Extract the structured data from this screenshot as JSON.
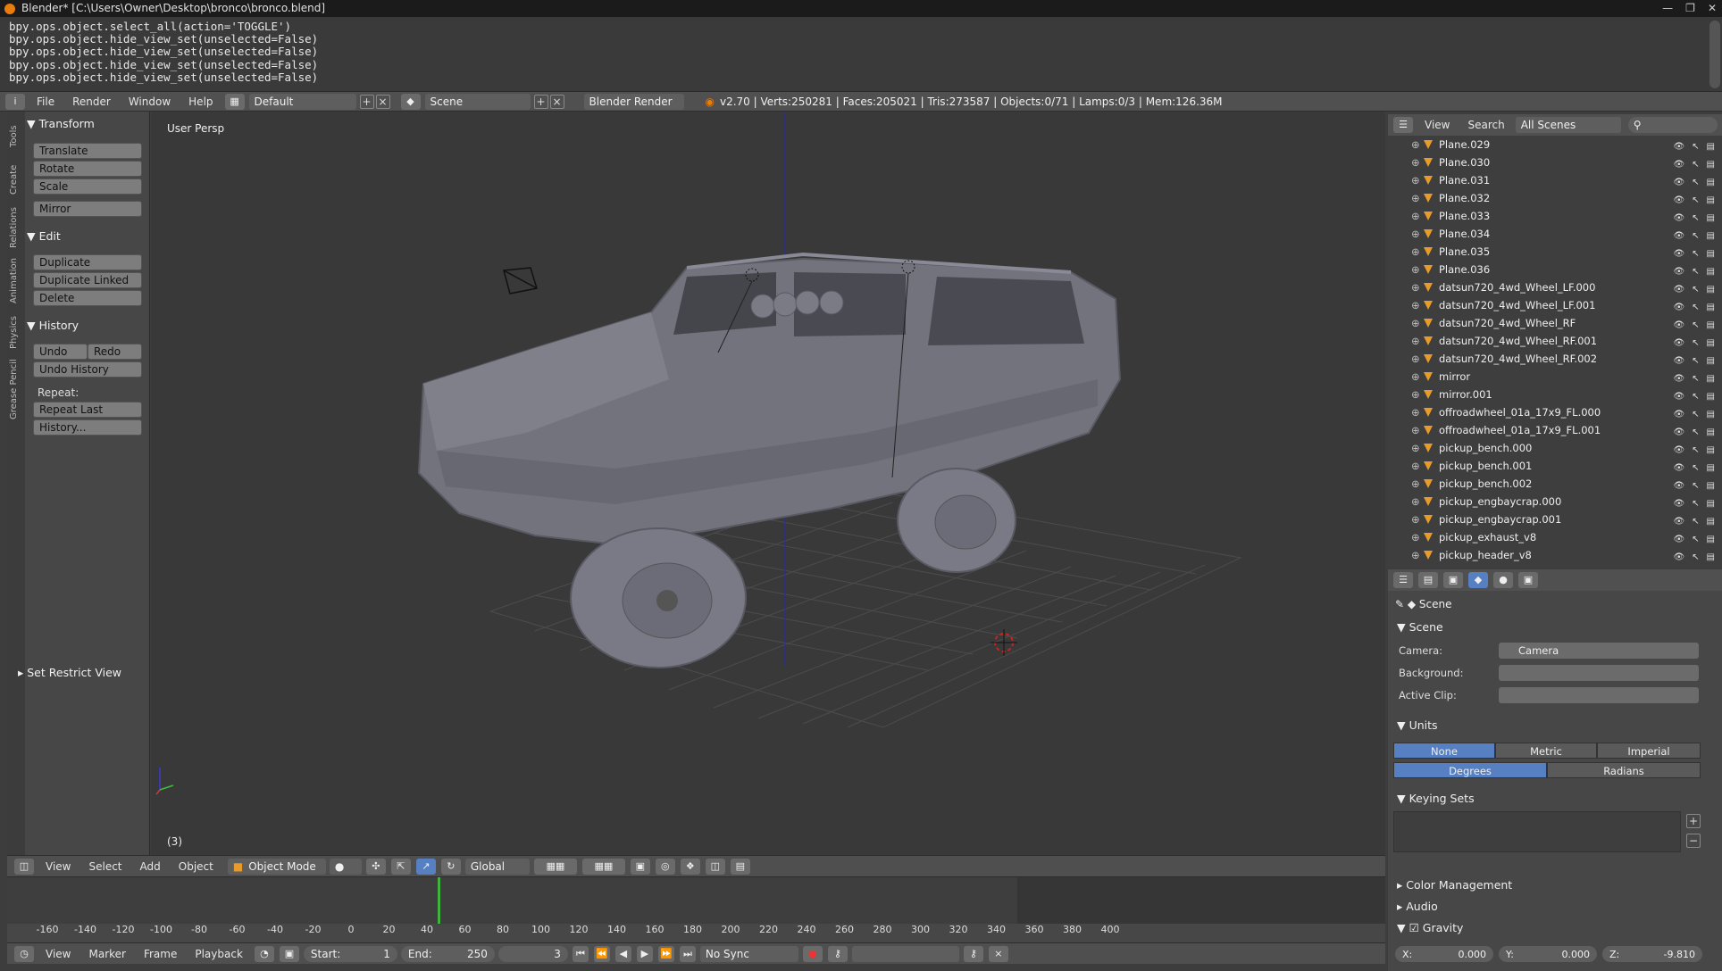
{
  "window": {
    "title": "Blender* [C:\\Users\\Owner\\Desktop\\bronco\\bronco.blend]"
  },
  "console": {
    "lines": [
      "bpy.ops.object.select_all(action='TOGGLE')",
      "bpy.ops.object.hide_view_set(unselected=False)",
      "bpy.ops.object.hide_view_set(unselected=False)",
      "bpy.ops.object.hide_view_set(unselected=False)",
      "bpy.ops.object.hide_view_set(unselected=False)"
    ]
  },
  "info": {
    "menus": [
      "File",
      "Render",
      "Window",
      "Help"
    ],
    "layout": "Default",
    "scene": "Scene",
    "engine": "Blender Render",
    "stats": "v2.70 | Verts:250281 | Faces:205021 | Tris:273587 | Objects:0/71 | Lamps:0/3 | Mem:126.36M"
  },
  "toolshelf": {
    "tabs": [
      "Tools",
      "Create",
      "Relations",
      "Animation",
      "Physics",
      "Grease Pencil"
    ],
    "transform_head": "Transform",
    "translate": "Translate",
    "rotate": "Rotate",
    "scale": "Scale",
    "mirror": "Mirror",
    "edit_head": "Edit",
    "duplicate": "Duplicate",
    "duplicate_linked": "Duplicate Linked",
    "delete": "Delete",
    "history_head": "History",
    "undo": "Undo",
    "redo": "Redo",
    "undo_history": "Undo History",
    "repeat_label": "Repeat:",
    "repeat_last": "Repeat Last",
    "history": "History...",
    "restrict": "Set Restrict View"
  },
  "viewport": {
    "label": "User Persp",
    "frame": "(3)"
  },
  "vp_header": {
    "menus": [
      "View",
      "Select",
      "Add",
      "Object"
    ],
    "mode": "Object Mode",
    "orientation": "Global"
  },
  "timeline": {
    "ticks": [
      "-160",
      "-140",
      "-120",
      "-100",
      "-80",
      "-60",
      "-40",
      "-20",
      "0",
      "20",
      "40",
      "60",
      "80",
      "100",
      "120",
      "140",
      "160",
      "180",
      "200",
      "220",
      "240",
      "260",
      "280",
      "300",
      "320",
      "340",
      "360",
      "380",
      "400"
    ],
    "menus": [
      "View",
      "Marker",
      "Frame",
      "Playback"
    ],
    "start_label": "Start:",
    "start": "1",
    "end_label": "End:",
    "end": "250",
    "current": "3",
    "sync": "No Sync"
  },
  "outliner": {
    "menus": [
      "View",
      "Search"
    ],
    "filter": "All Scenes",
    "rows": [
      "Plane.029",
      "Plane.030",
      "Plane.031",
      "Plane.032",
      "Plane.033",
      "Plane.034",
      "Plane.035",
      "Plane.036",
      "datsun720_4wd_Wheel_LF.000",
      "datsun720_4wd_Wheel_LF.001",
      "datsun720_4wd_Wheel_RF",
      "datsun720_4wd_Wheel_RF.001",
      "datsun720_4wd_Wheel_RF.002",
      "mirror",
      "mirror.001",
      "offroadwheel_01a_17x9_FL.000",
      "offroadwheel_01a_17x9_FL.001",
      "pickup_bench.000",
      "pickup_bench.001",
      "pickup_bench.002",
      "pickup_engbaycrap.000",
      "pickup_engbaycrap.001",
      "pickup_exhaust_v8",
      "pickup_header_v8"
    ]
  },
  "properties": {
    "context": "Scene",
    "scene_head": "Scene",
    "camera_label": "Camera:",
    "camera": "Camera",
    "background_label": "Background:",
    "background": "",
    "clip_label": "Active Clip:",
    "clip": "",
    "units_head": "Units",
    "unit_system": [
      "None",
      "Metric",
      "Imperial"
    ],
    "rotation_units": [
      "Degrees",
      "Radians"
    ],
    "keying_head": "Keying Sets",
    "color_mgmt": "Color Management",
    "audio": "Audio",
    "gravity": "Gravity",
    "gx_label": "X:",
    "gx": "0.000",
    "gy_label": "Y:",
    "gy": "0.000",
    "gz_label": "Z:",
    "gz": "-9.810"
  },
  "colors": {
    "accent": "#5680c2",
    "object_orange": "#e89a2b"
  }
}
